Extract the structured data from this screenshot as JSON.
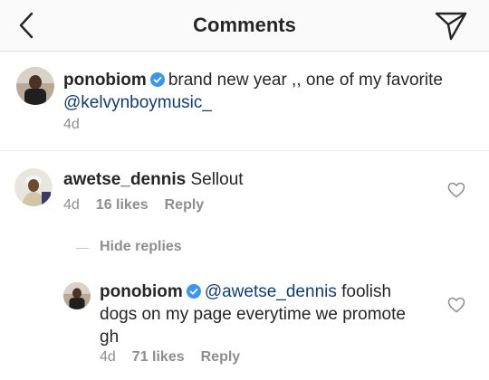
{
  "header": {
    "title": "Comments"
  },
  "post_caption": {
    "username": "ponobiom",
    "text": "brand new year ,, one of my favorite",
    "mention": "@kelvynboymusic_",
    "time": "4d"
  },
  "comments": [
    {
      "username": "awetse_dennis",
      "text": "Sellout",
      "time": "4d",
      "likes": "16 likes",
      "reply_label": "Reply"
    }
  ],
  "hide_replies_label": "Hide replies",
  "replies": [
    {
      "username": "ponobiom",
      "mention": "@awetse_dennis",
      "text": "foolish dogs on my page everytime we promote gh",
      "time": "4d",
      "likes": "71 likes",
      "reply_label": "Reply"
    }
  ],
  "colors": {
    "verified": "#3897f0",
    "mention": "#0f3c7a",
    "meta": "#8e8e8e"
  }
}
